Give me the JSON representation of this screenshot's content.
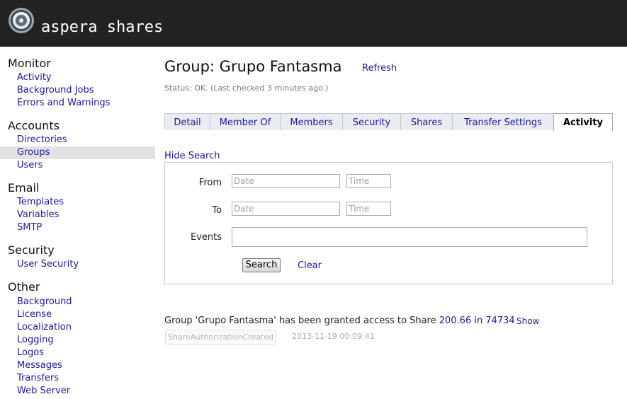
{
  "header": {
    "brand": "aspera shares",
    "logo_icon": "aspera-logo-icon"
  },
  "sidebar": {
    "sections": [
      {
        "title": "Monitor",
        "items": [
          "Activity",
          "Background Jobs",
          "Errors and Warnings"
        ]
      },
      {
        "title": "Accounts",
        "items": [
          "Directories",
          "Groups",
          "Users"
        ]
      },
      {
        "title": "Email",
        "items": [
          "Templates",
          "Variables",
          "SMTP"
        ]
      },
      {
        "title": "Security",
        "items": [
          "User Security"
        ]
      },
      {
        "title": "Other",
        "items": [
          "Background",
          "License",
          "Localization",
          "Logging",
          "Logos",
          "Messages",
          "Transfers",
          "Web Server"
        ]
      }
    ],
    "selected": "Groups"
  },
  "main": {
    "title": "Group: Grupo Fantasma",
    "refresh": "Refresh",
    "status": "Status: OK. (Last checked 3 minutes ago.)",
    "tabs": [
      "Detail",
      "Member Of",
      "Members",
      "Security",
      "Shares",
      "Transfer Settings",
      "Activity"
    ],
    "active_tab": "Activity",
    "hide_search": "Hide Search",
    "search": {
      "from_label": "From",
      "to_label": "To",
      "events_label": "Events",
      "date_placeholder": "Date",
      "time_placeholder": "Time",
      "events_value": "",
      "search_button": "Search",
      "clear": "Clear"
    },
    "event": {
      "text_prefix": "Group 'Grupo Fantasma' has been granted access to Share",
      "share_link": "200.66 in 74734",
      "show": "Show",
      "badge": "ShareAuthorizationCreated",
      "timestamp": "2013-11-19 00:09:41"
    }
  },
  "colors": {
    "header_bg": "#222222",
    "link": "#1a1aa6",
    "selected_bg": "#e2e2e2"
  }
}
